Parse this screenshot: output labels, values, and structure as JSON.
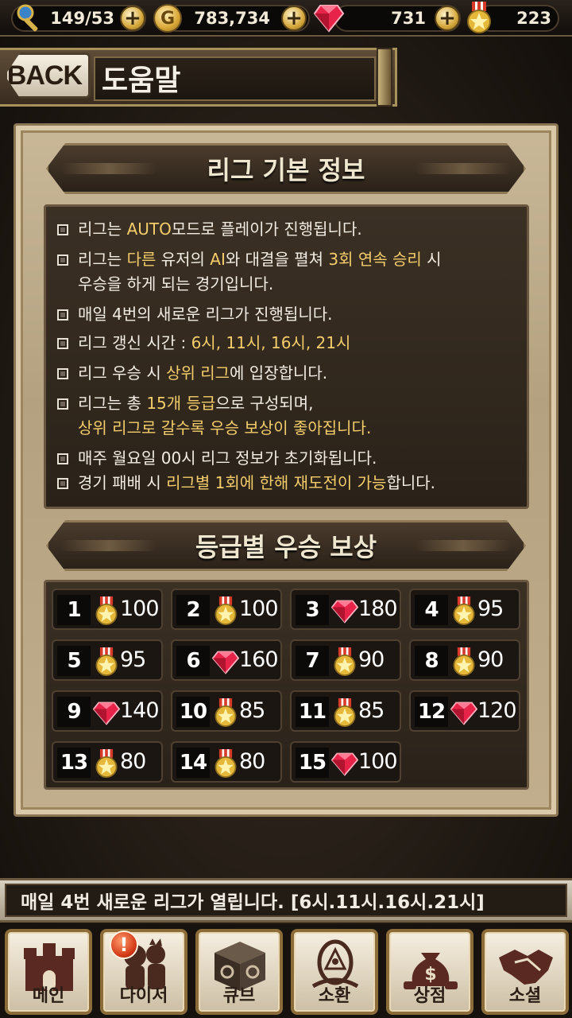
{
  "resources": {
    "stamina": {
      "value": "149/53",
      "icon": "key-wand-icon"
    },
    "gold": {
      "value": "783,734",
      "icon": "gold-coin-icon",
      "coin_letter": "G"
    },
    "gems": {
      "value": "731",
      "icon": "ruby-gem-icon"
    },
    "medals": {
      "value": "223",
      "icon": "star-medal-icon"
    },
    "plus_symbol": "+"
  },
  "header": {
    "back_label": "BACK",
    "title": "도움말"
  },
  "league_info": {
    "title": "리그 기본 정보",
    "lines": [
      {
        "parts": [
          {
            "t": "리그는 ",
            "hl": false
          },
          {
            "t": "AUTO",
            "hl": true
          },
          {
            "t": "모드로 플레이가 진행됩니다.",
            "hl": false
          }
        ]
      },
      {
        "parts": [
          {
            "t": "리그는 ",
            "hl": false
          },
          {
            "t": "다른",
            "hl": true
          },
          {
            "t": " 유저의 ",
            "hl": false
          },
          {
            "t": "AI",
            "hl": true
          },
          {
            "t": "와 대결을 펼쳐 ",
            "hl": false
          },
          {
            "t": "3회 연속 승리",
            "hl": true
          },
          {
            "t": " 시",
            "hl": false
          }
        ]
      },
      {
        "parts": [
          {
            "t": "우승을 하게 되는 경기입니다.",
            "hl": false
          }
        ],
        "indent": true
      },
      {
        "parts": [
          {
            "t": "매일 4번의 새로운 리그가 진행됩니다.",
            "hl": false
          }
        ]
      },
      {
        "parts": [
          {
            "t": "리그 갱신 시간 : ",
            "hl": false
          },
          {
            "t": "6시, 11시, 16시, 21시",
            "hl": true
          }
        ]
      },
      {
        "parts": [
          {
            "t": "리그 우승 시 ",
            "hl": false
          },
          {
            "t": "상위 리그",
            "hl": true
          },
          {
            "t": "에 입장합니다.",
            "hl": false
          }
        ]
      },
      {
        "parts": [
          {
            "t": "리그는 총 ",
            "hl": false
          },
          {
            "t": "15개 등급",
            "hl": true
          },
          {
            "t": "으로 구성되며,",
            "hl": false
          }
        ]
      },
      {
        "parts": [
          {
            "t": "상위 리그로 갈수록 우승 보상이 좋아집니다.",
            "hl": true
          }
        ],
        "indent": true
      },
      {
        "parts": [
          {
            "t": "매주 월요일 00시 리그 정보가 초기화됩니다.",
            "hl": false
          }
        ]
      },
      {
        "parts": [
          {
            "t": "경기 패배 시 ",
            "hl": false
          },
          {
            "t": "리그별 1회에 한해 재도전이 가능",
            "hl": true
          },
          {
            "t": "합니다.",
            "hl": false
          }
        ]
      }
    ]
  },
  "rewards": {
    "title": "등급별 우승 보상",
    "items": [
      {
        "rank": "1",
        "type": "medal",
        "amount": "100"
      },
      {
        "rank": "2",
        "type": "medal",
        "amount": "100"
      },
      {
        "rank": "3",
        "type": "gem",
        "amount": "180"
      },
      {
        "rank": "4",
        "type": "medal",
        "amount": "95"
      },
      {
        "rank": "5",
        "type": "medal",
        "amount": "95"
      },
      {
        "rank": "6",
        "type": "gem",
        "amount": "160"
      },
      {
        "rank": "7",
        "type": "medal",
        "amount": "90"
      },
      {
        "rank": "8",
        "type": "medal",
        "amount": "90"
      },
      {
        "rank": "9",
        "type": "gem",
        "amount": "140"
      },
      {
        "rank": "10",
        "type": "medal",
        "amount": "85"
      },
      {
        "rank": "11",
        "type": "medal",
        "amount": "85"
      },
      {
        "rank": "12",
        "type": "gem",
        "amount": "120"
      },
      {
        "rank": "13",
        "type": "medal",
        "amount": "80"
      },
      {
        "rank": "14",
        "type": "medal",
        "amount": "80"
      },
      {
        "rank": "15",
        "type": "gem",
        "amount": "100"
      }
    ]
  },
  "ticker": {
    "text": "매일 4번 새로운 리그가 열립니다. [6시.11시.16시.21시]"
  },
  "nav": {
    "items": [
      {
        "label": "메인",
        "icon": "castle-icon"
      },
      {
        "label": "다이서",
        "icon": "dicer-characters-icon",
        "alert": "!"
      },
      {
        "label": "큐브",
        "icon": "cube-icon"
      },
      {
        "label": "소환",
        "icon": "summon-portal-icon"
      },
      {
        "label": "상점",
        "icon": "money-bag-icon"
      },
      {
        "label": "소셜",
        "icon": "handshake-icon"
      }
    ]
  },
  "colors": {
    "highlight": "#f4cd6a",
    "panel": "#c9b898",
    "dark_box": "#2a2219"
  }
}
